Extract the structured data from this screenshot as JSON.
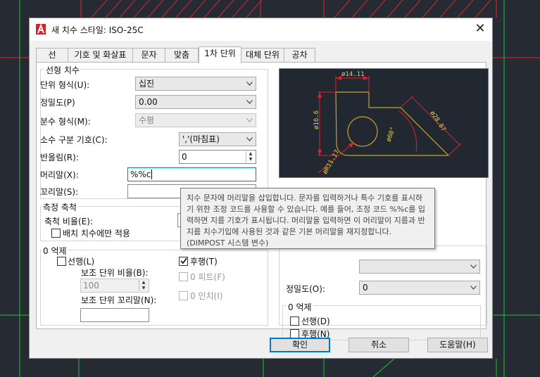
{
  "dialog": {
    "title": "새 치수 스타일: ISO-25C",
    "close_glyph": "✕"
  },
  "tabs": [
    "선",
    "기호 및 화살표",
    "문자",
    "맞춤",
    "1차 단위",
    "대체 단위",
    "공차"
  ],
  "active_tab": "1차 단위",
  "linear": {
    "group_label": "선형 치수",
    "unit_format_label": "단위 형식(U):",
    "unit_format_value": "십진",
    "precision_label": "정밀도(P)",
    "precision_value": "0.00",
    "fraction_label": "분수 형식(M):",
    "fraction_value": "수평",
    "decimal_sep_label": "소수 구분 기호(C):",
    "decimal_sep_value": "','(마침표)",
    "roundoff_label": "반올림(R):",
    "roundoff_value": "0",
    "prefix_label": "머리말(X):",
    "prefix_value": "%%c",
    "suffix_label": "꼬리말(S):",
    "suffix_value": ""
  },
  "scale": {
    "group_label": "측정 축척",
    "factor_label": "축척 비율(E):",
    "layout_only_label": "배치 치수에만 적용"
  },
  "zero_suppression": {
    "group_label": "0 억제",
    "leading_label": "선행(L)",
    "leading_checked": false,
    "trailing_label": "후행(T)",
    "trailing_checked": true,
    "sub_unit_factor_label": "보조 단위 비율(B):",
    "sub_unit_factor_value": "100",
    "sub_unit_suffix_label": "보조 단위 꼬리말(N):",
    "sub_unit_suffix_value": "",
    "feet_label": "0 피트(F)",
    "inches_label": "0 인치(I)"
  },
  "angular": {
    "precision_label": "정밀도(O):",
    "precision_value": "0",
    "zero_group_label": "0 억제",
    "leading_label": "선행(D)",
    "trailing_label": "후행(N)"
  },
  "tooltip": {
    "text": "치수 문자에 머리말을 삽입합니다. 문자를 입력하거나 특수 기호를 표시하기 위한 조정 코드를 사용할 수 있습니다. 예를 들어, 조정 코드 %%c를 입력하면 지름 기호가 표시됩니다. 머리말을 입력하면 이 머리말이 지름과 반지름 치수기입에 사용된 것과 같은 기본 머리말을 재지정합니다. (DIMPOST 시스템 변수)"
  },
  "preview": {
    "dim_top": "ø14.11",
    "dim_left": "ø16.6",
    "dim_right": "ø28.07",
    "dim_angle": "ø60°",
    "dim_radius": "øR11.17"
  },
  "buttons": {
    "ok": "확인",
    "cancel": "취소",
    "help": "도움말(H)"
  },
  "colors": {
    "accent": "#0078d7",
    "cad_background": "#222831",
    "cad_geometry": "#c9a227",
    "cad_dimension": "#e0202a",
    "cad_text": "#e6d04a"
  }
}
